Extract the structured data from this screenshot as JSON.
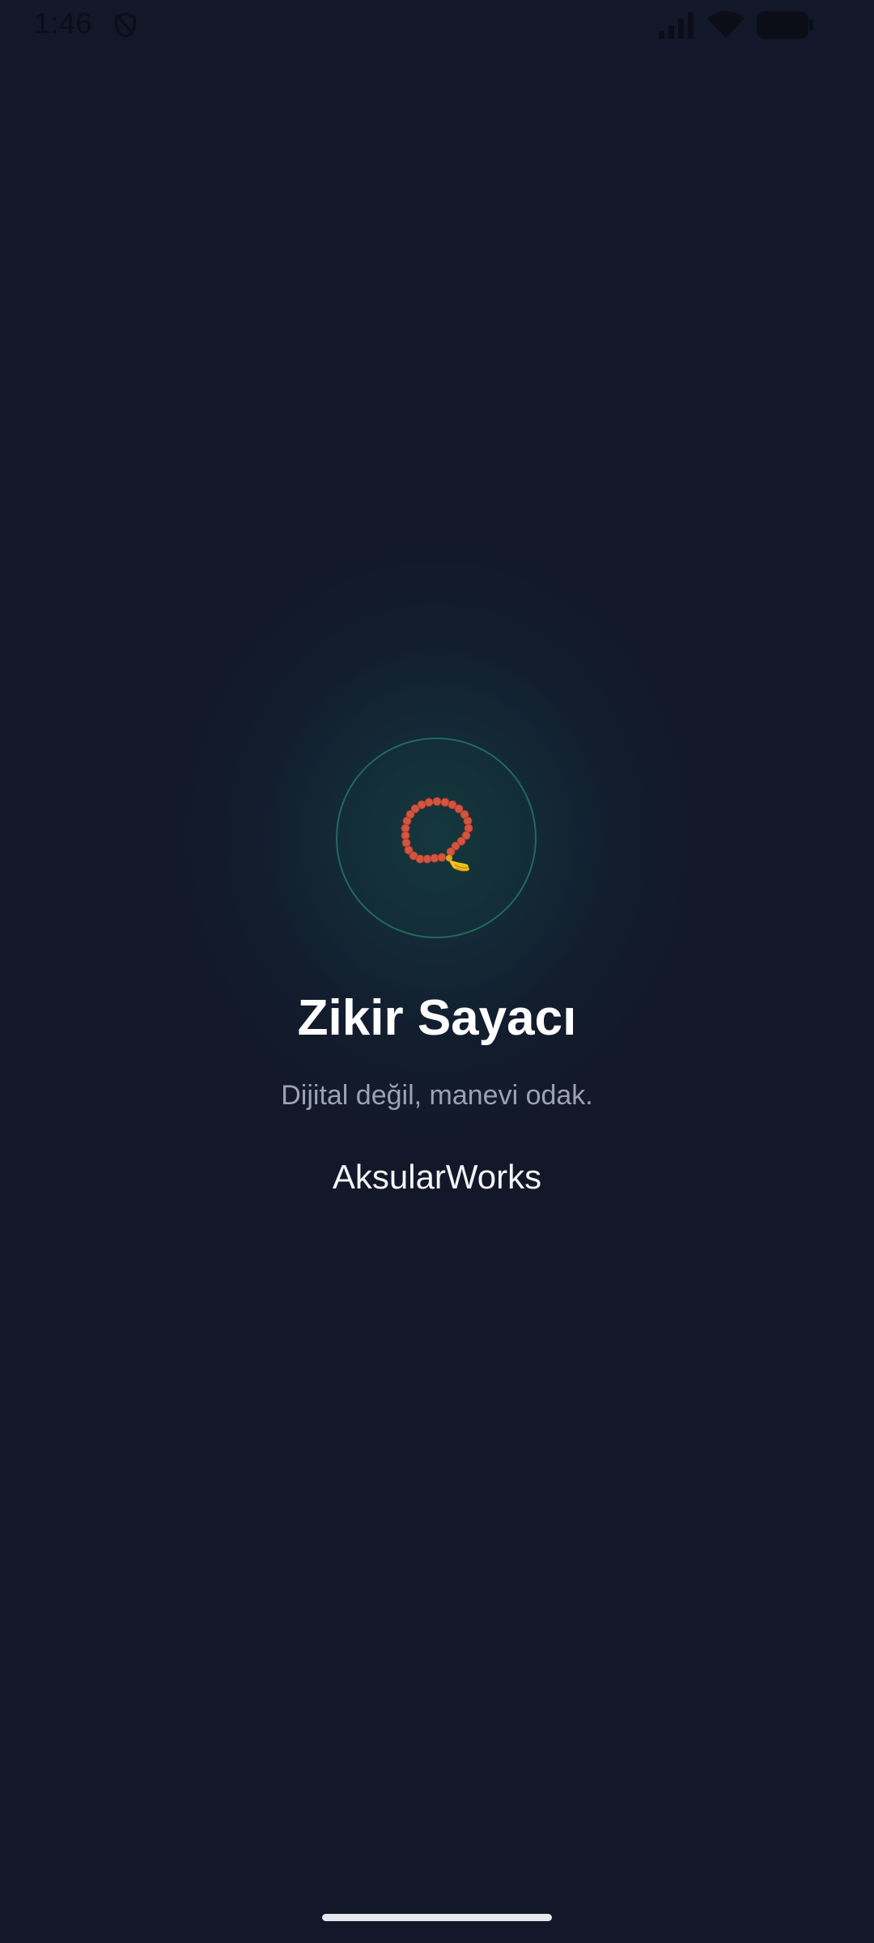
{
  "status_bar": {
    "time": "1:46",
    "icons": [
      "shield-icon",
      "cellular-signal-icon",
      "wifi-icon",
      "battery-icon"
    ]
  },
  "splash": {
    "logo_icon": "prayer-beads-icon",
    "title": "Zikir Sayacı",
    "tagline": "Dijital değil, manevi odak.",
    "brand": "AksularWorks"
  },
  "colors": {
    "background": "#121729",
    "ring": "#21695f",
    "glow": "#164648",
    "title": "#ffffff",
    "tagline": "#9aa2b3",
    "bead": "#d2553f",
    "tassel": "#f2c21b"
  }
}
